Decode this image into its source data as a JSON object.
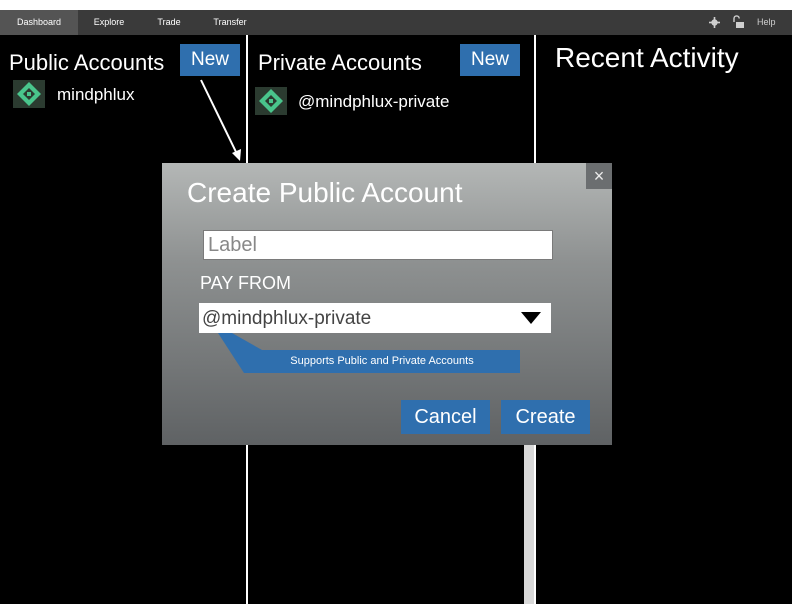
{
  "nav": {
    "tabs": [
      "Dashboard",
      "Explore",
      "Trade",
      "Transfer"
    ],
    "active_tab": "Dashboard",
    "help_label": "Help",
    "settings_icon": "gear-icon",
    "lock_icon": "unlock-icon"
  },
  "public_accounts": {
    "title": "Public Accounts",
    "new_label": "New",
    "accounts": [
      {
        "name": "mindphlux",
        "icon": "identicon"
      }
    ]
  },
  "private_accounts": {
    "title": "Private Accounts",
    "new_label": "New",
    "accounts": [
      {
        "name": "@mindphlux-private",
        "icon": "identicon"
      }
    ]
  },
  "recent_activity": {
    "title": "Recent Activity"
  },
  "modal": {
    "title": "Create Public Account",
    "close_glyph": "×",
    "label_placeholder": "Label",
    "pay_from_label": "PAY FROM",
    "pay_from_value": "@mindphlux-private",
    "tooltip": "Supports Public and Private Accounts",
    "cancel_label": "Cancel",
    "create_label": "Create"
  },
  "colors": {
    "accent": "#2f6fae",
    "nav_bg": "#3a3a3a",
    "background": "#000000"
  }
}
